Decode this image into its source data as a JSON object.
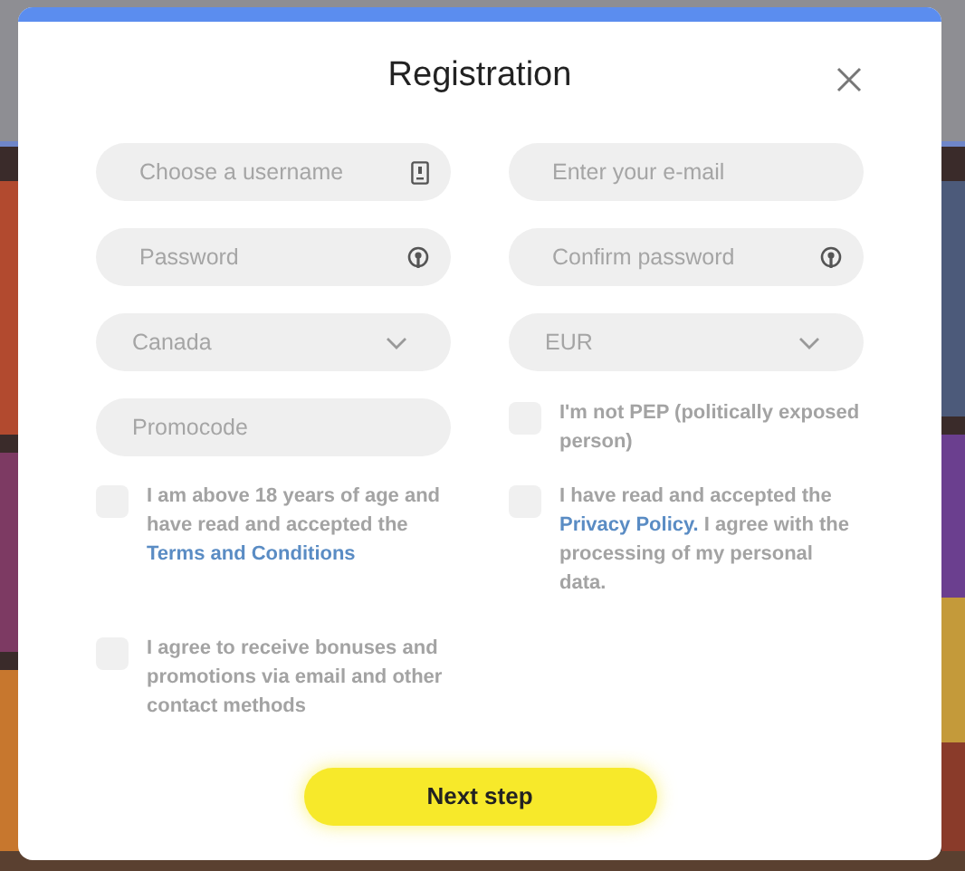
{
  "dialog": {
    "title": "Registration"
  },
  "fields": [
    {
      "kind": "username",
      "placeholder": "Choose a username"
    },
    {
      "kind": "email",
      "placeholder": "Enter your e-mail"
    },
    {
      "kind": "password",
      "placeholder": "Password"
    },
    {
      "kind": "password",
      "placeholder": "Confirm password"
    },
    {
      "kind": "select",
      "value": "Canada"
    },
    {
      "kind": "select",
      "value": "EUR"
    }
  ],
  "promocode": {
    "placeholder": "Promocode"
  },
  "checkboxes": [
    {
      "checked": false,
      "parts": [
        {
          "text": "I'm not PEP (politically exposed person)",
          "link": false
        }
      ]
    },
    {
      "checked": false,
      "parts": [
        {
          "text": "I am above 18 years of age and have read and accepted the ",
          "link": false
        },
        {
          "text": "Terms and Conditions",
          "link": true
        }
      ]
    },
    {
      "checked": false,
      "parts": [
        {
          "text": "I have read and accepted the ",
          "link": false
        },
        {
          "text": "Privacy Policy.",
          "link": true
        },
        {
          "text": " I agree with the processing of my personal data.",
          "link": false
        }
      ]
    },
    {
      "checked": false,
      "parts": [
        {
          "text": "I agree to receive bonuses and promotions via email and other contact methods",
          "link": false
        }
      ]
    }
  ],
  "submit": {
    "label": "Next step"
  }
}
